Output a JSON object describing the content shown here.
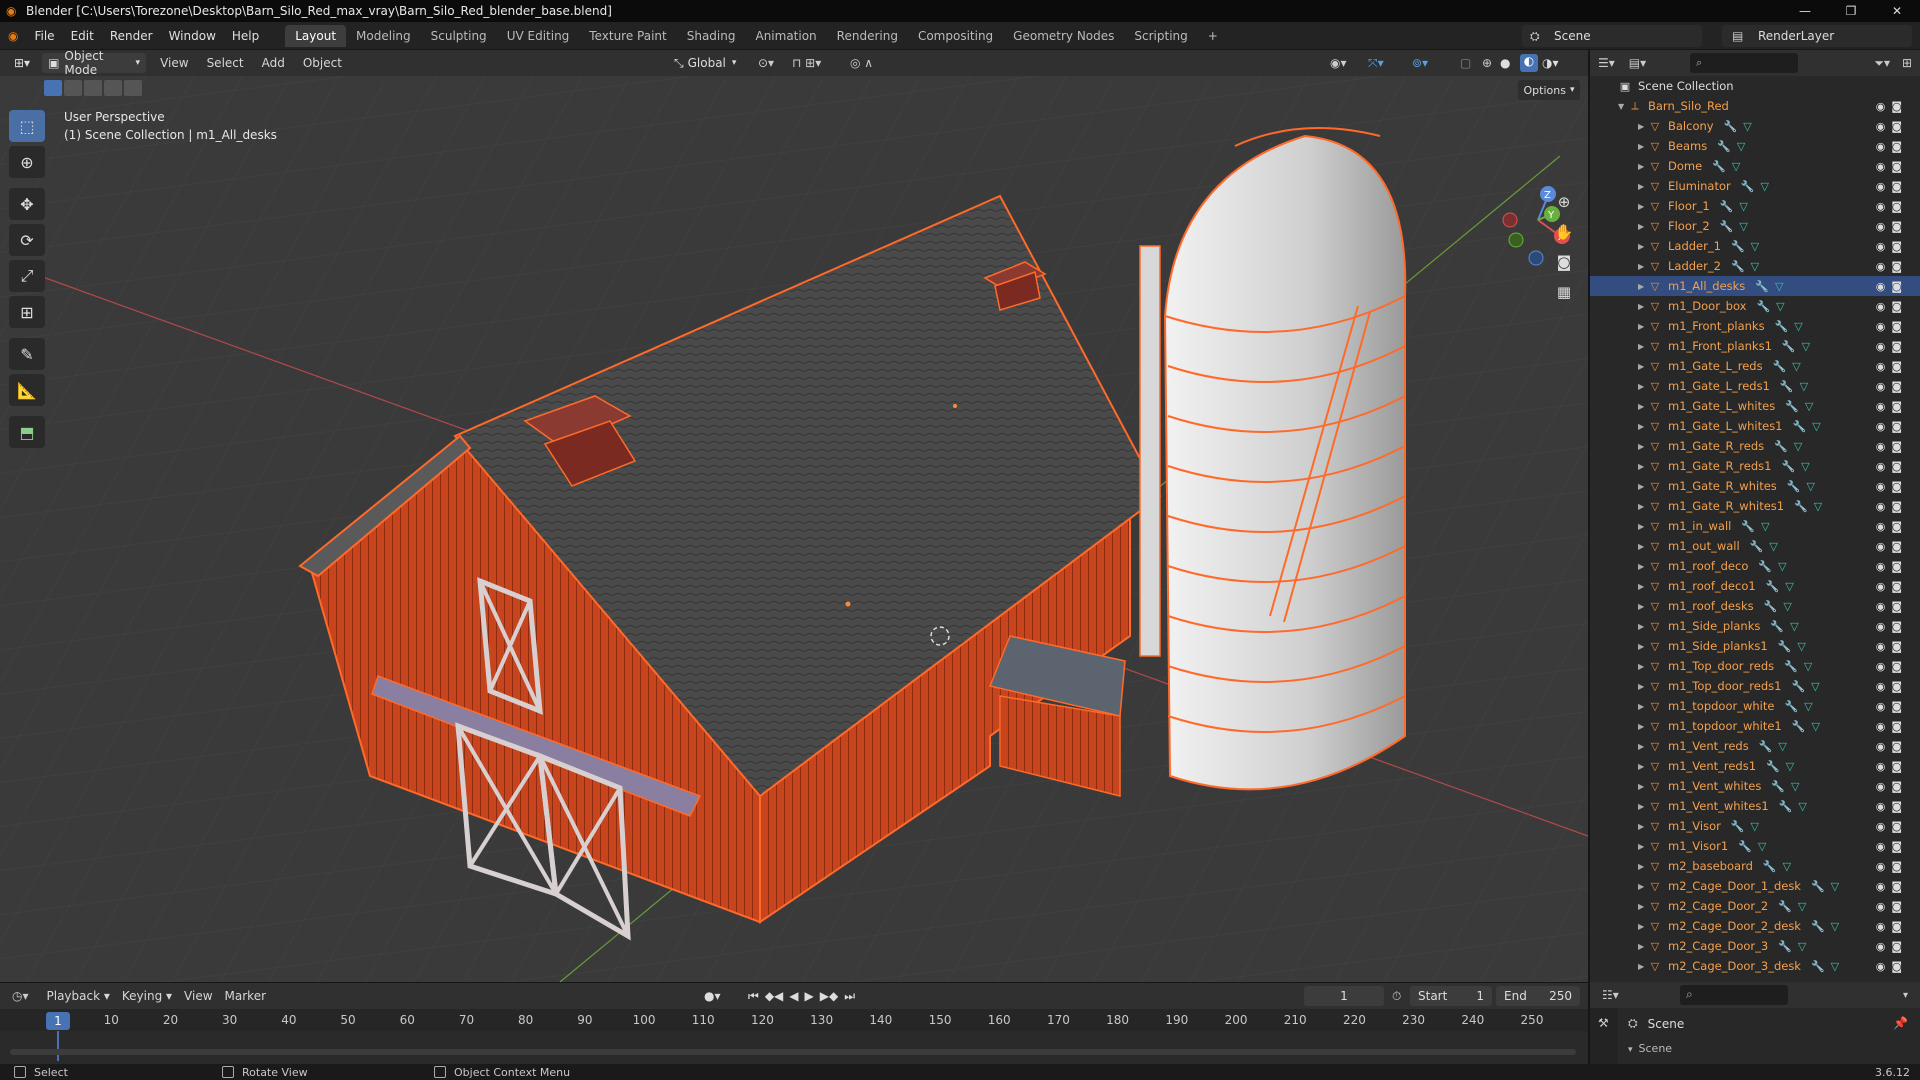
{
  "window": {
    "title": "Blender [C:\\Users\\Torezone\\Desktop\\Barn_Silo_Red_max_vray\\Barn_Silo_Red_blender_base.blend]",
    "controls": [
      "minimize-icon",
      "maximize-icon",
      "close-icon"
    ]
  },
  "menu": {
    "items": [
      "File",
      "Edit",
      "Render",
      "Window",
      "Help"
    ]
  },
  "workspaces": {
    "tabs": [
      "Layout",
      "Modeling",
      "Sculpting",
      "UV Editing",
      "Texture Paint",
      "Shading",
      "Animation",
      "Rendering",
      "Compositing",
      "Geometry Nodes",
      "Scripting"
    ],
    "active": "Layout",
    "add_symbol": "+"
  },
  "scene": {
    "label": "Scene"
  },
  "render_layer": {
    "label": "RenderLayer"
  },
  "viewport_header": {
    "mode": "Object Mode",
    "menus": [
      "View",
      "Select",
      "Add",
      "Object"
    ],
    "transform_orientation": "Global",
    "options_label": "Options"
  },
  "viewport": {
    "perspective": "User Perspective",
    "collection_info": "(1) Scene Collection | m1_All_desks",
    "axes": {
      "x": "X",
      "y": "Y",
      "z": "Z"
    },
    "model_colors": {
      "barn_red": "#c8441c",
      "selection_outline": "#ff6a2a",
      "roof": "#4a4a4a",
      "silo": "#d6d6d6"
    }
  },
  "outliner": {
    "root": "Scene Collection",
    "collection": "Barn_Silo_Red",
    "selected": "m1_All_desks",
    "objects": [
      "Balcony",
      "Beams",
      "Dome",
      "Eluminator",
      "Floor_1",
      "Floor_2",
      "Ladder_1",
      "Ladder_2",
      "m1_All_desks",
      "m1_Door_box",
      "m1_Front_planks",
      "m1_Front_planks1",
      "m1_Gate_L_reds",
      "m1_Gate_L_reds1",
      "m1_Gate_L_whites",
      "m1_Gate_L_whites1",
      "m1_Gate_R_reds",
      "m1_Gate_R_reds1",
      "m1_Gate_R_whites",
      "m1_Gate_R_whites1",
      "m1_in_wall",
      "m1_out_wall",
      "m1_roof_deco",
      "m1_roof_deco1",
      "m1_roof_desks",
      "m1_Side_planks",
      "m1_Side_planks1",
      "m1_Top_door_reds",
      "m1_Top_door_reds1",
      "m1_topdoor_white",
      "m1_topdoor_white1",
      "m1_Vent_reds",
      "m1_Vent_reds1",
      "m1_Vent_whites",
      "m1_Vent_whites1",
      "m1_Visor",
      "m1_Visor1",
      "m2_baseboard",
      "m2_Cage_Door_1_desk",
      "m2_Cage_Door_2",
      "m2_Cage_Door_2_desk",
      "m2_Cage_Door_3",
      "m2_Cage_Door_3_desk"
    ]
  },
  "timeline": {
    "menus": [
      "Playback",
      "Keying",
      "View",
      "Marker"
    ],
    "current_frame": "1",
    "start_label": "Start",
    "start_value": "1",
    "end_label": "End",
    "end_value": "250",
    "ticks": [
      "10",
      "20",
      "30",
      "40",
      "50",
      "60",
      "70",
      "80",
      "90",
      "100",
      "110",
      "120",
      "130",
      "140",
      "150",
      "160",
      "170",
      "180",
      "190",
      "200",
      "210",
      "220",
      "230",
      "240",
      "250"
    ],
    "playhead_label": "1"
  },
  "properties": {
    "scene_label": "Scene",
    "sub_label": "Scene"
  },
  "statusbar": {
    "select": "Select",
    "rotate": "Rotate View",
    "context": "Object Context Menu",
    "version": "3.6.12"
  }
}
